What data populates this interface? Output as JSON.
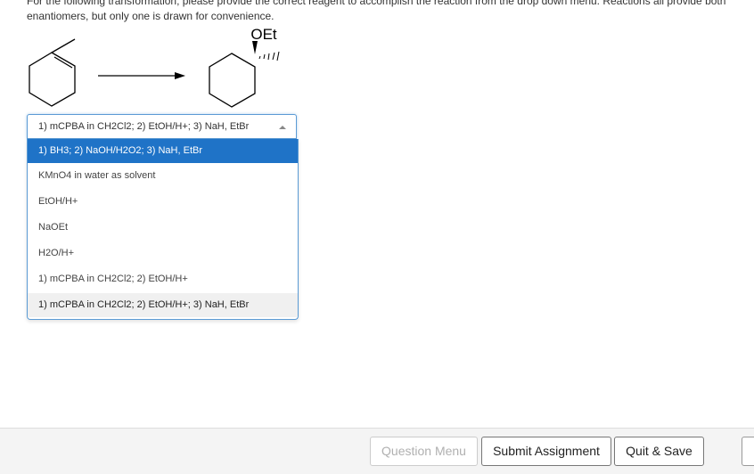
{
  "instructions": {
    "line1": "For the following transformation, please provide the correct reagent to accomplish the reaction from the drop down menu. Reactions all provide both",
    "line2": "enantiomers, but only one is drawn for convenience."
  },
  "scheme": {
    "product_group": "OEt"
  },
  "reagent_select": {
    "selected_value": "1) mCPBA in CH2Cl2; 2) EtOH/H+; 3) NaH, EtBr",
    "options": [
      "1) BH3; 2) NaOH/H2O2; 3) NaH, EtBr",
      "KMnO4 in water as solvent",
      "EtOH/H+",
      "NaOEt",
      "H2O/H+",
      "1) mCPBA in CH2Cl2; 2) EtOH/H+",
      "1) mCPBA in CH2Cl2; 2) EtOH/H+; 3) NaH, EtBr"
    ],
    "highlighted_option": "1) BH3; 2) NaOH/H2O2; 3) NaH, EtBr"
  },
  "footer": {
    "question_menu_label": "Question Menu",
    "submit_label": "Submit Assignment",
    "quit_label": "Quit & Save"
  },
  "colors": {
    "highlight": "#1f73c7",
    "focus_border": "#5b9bd5",
    "disabled_text": "#b0b0b0"
  }
}
